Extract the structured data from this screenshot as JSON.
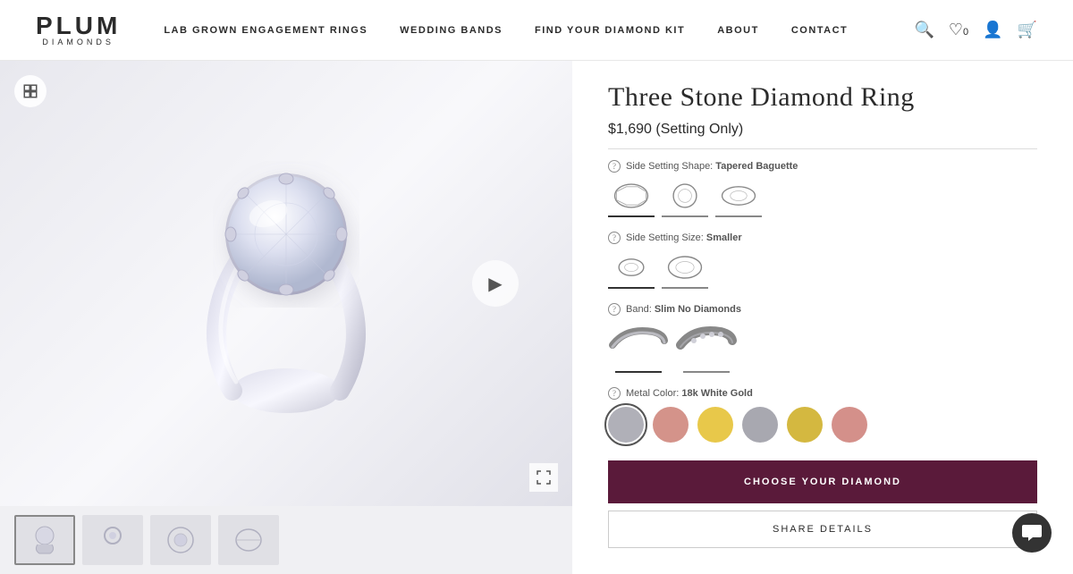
{
  "header": {
    "logo_top": "PLUM",
    "logo_bottom": "DIAMONDS",
    "nav_items": [
      {
        "label": "Lab Grown Engagement Rings",
        "id": "lab-grown"
      },
      {
        "label": "Wedding Bands",
        "id": "wedding-bands"
      },
      {
        "label": "Find Your Diamond Kit",
        "id": "find-diamond-kit"
      },
      {
        "label": "About",
        "id": "about"
      },
      {
        "label": "Contact",
        "id": "contact"
      }
    ],
    "wishlist_count": "0"
  },
  "product": {
    "title": "Three Stone Diamond Ring",
    "price": "$1,690 (Setting Only)",
    "options": {
      "side_setting_shape": {
        "label": "Side Setting Shape:",
        "value": "Tapered Baguette",
        "choices": [
          "Tapered Baguette",
          "Round",
          "Oval"
        ]
      },
      "side_setting_size": {
        "label": "Side Setting Size:",
        "value": "Smaller",
        "choices": [
          "Smaller",
          "Larger"
        ]
      },
      "band": {
        "label": "Band:",
        "value": "Slim No Diamonds",
        "choices": [
          "Slim No Diamonds",
          "Pave"
        ]
      },
      "metal_color": {
        "label": "Metal Color:",
        "value": "18k White Gold",
        "swatches": [
          {
            "name": "White Gold 18k",
            "color": "#b0b0b8",
            "active": true
          },
          {
            "name": "Rose Gold 18k",
            "color": "#d4938a",
            "active": false
          },
          {
            "name": "Yellow Gold 18k",
            "color": "#e8c84a",
            "active": false
          },
          {
            "name": "Platinum",
            "color": "#a8a8b0",
            "active": false
          },
          {
            "name": "Yellow Gold 14k",
            "color": "#d4b840",
            "active": false
          },
          {
            "name": "Rose Gold 14k",
            "color": "#d4908a",
            "active": false
          }
        ]
      }
    },
    "cta_choose": "Choose Your Diamond",
    "cta_share": "Share Details"
  }
}
